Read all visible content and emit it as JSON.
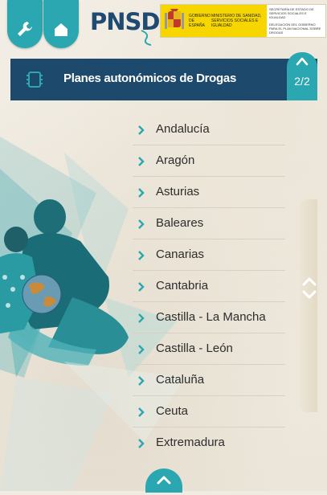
{
  "header": {
    "logo_text": "PNSD",
    "tools_button_icon": "wrench-icon",
    "home_button_icon": "home-icon",
    "ministry_block": {
      "gobierno_label": "GOBIERNO DE ESPAÑA",
      "ministry_label": "MINISTERIO DE SANIDAD, SERVICIOS SOCIALES E IGUALDAD",
      "secretaria_label": "SECRETARÍA DE ESTADO DE SERVICIOS SOCIALES E IGUALDAD",
      "delegacion_label": "DELEGACIÓN DEL GOBIERNO PARA EL PLAN NACIONAL SOBRE DROGAS"
    }
  },
  "title_bar": {
    "icon": "chip-icon",
    "title": "Planes autonómicos de Drogas",
    "page_indicator": "2/2"
  },
  "regions": [
    {
      "label": "Andalucía"
    },
    {
      "label": "Aragón"
    },
    {
      "label": "Asturias"
    },
    {
      "label": "Baleares"
    },
    {
      "label": "Canarias"
    },
    {
      "label": "Cantabria"
    },
    {
      "label": "Castilla - La Mancha"
    },
    {
      "label": "Castilla - León"
    },
    {
      "label": "Cataluña"
    },
    {
      "label": "Ceuta"
    },
    {
      "label": "Extremadura"
    }
  ],
  "colors": {
    "accent_teal": "#2aa7b0",
    "title_bar_navy": "#1d4a6c",
    "background_paper": "#f1ece2",
    "gov_yellow": "#f7d600"
  }
}
